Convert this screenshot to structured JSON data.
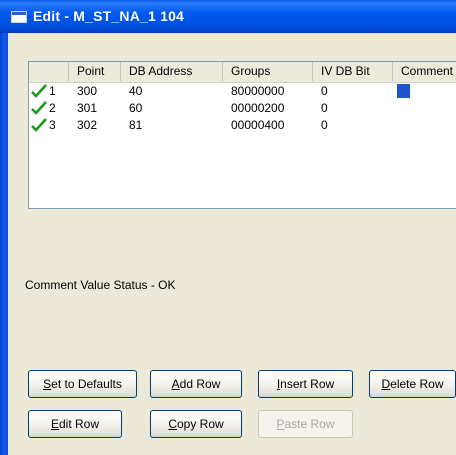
{
  "window": {
    "title": "Edit - M_ST_NA_1 104"
  },
  "list": {
    "columns": [
      "",
      "Point",
      "DB Address",
      "Groups",
      "IV DB Bit",
      "Comment"
    ],
    "rows": [
      {
        "index": "1",
        "point": "300",
        "db_address": "40",
        "groups": "80000000",
        "iv_db_bit": "0",
        "comment": "",
        "checked": true
      },
      {
        "index": "2",
        "point": "301",
        "db_address": "60",
        "groups": "00000200",
        "iv_db_bit": "0",
        "comment": "",
        "checked": true
      },
      {
        "index": "3",
        "point": "302",
        "db_address": "81",
        "groups": "00000400",
        "iv_db_bit": "0",
        "comment": "",
        "checked": true
      }
    ]
  },
  "status": {
    "text": "Comment Value Status - OK"
  },
  "buttons": {
    "set_defaults": {
      "mnemonic": "S",
      "rest": "et to Defaults"
    },
    "add_row": {
      "mnemonic": "A",
      "rest": "dd Row"
    },
    "insert_row": {
      "mnemonic": "I",
      "rest": "nsert Row"
    },
    "delete_row": {
      "mnemonic": "D",
      "rest": "elete Row"
    },
    "edit_row": {
      "mnemonic": "E",
      "rest": "dit Row"
    },
    "copy_row": {
      "mnemonic": "C",
      "rest": "opy Row"
    },
    "paste_row": {
      "mnemonic": "P",
      "rest": "aste Row"
    }
  },
  "colors": {
    "titlebar": "#0058ee",
    "check": "#1a9a1a",
    "selection": "#1d55cc"
  },
  "icons": {
    "title": "window-icon",
    "row_state": "checkmark-icon"
  }
}
